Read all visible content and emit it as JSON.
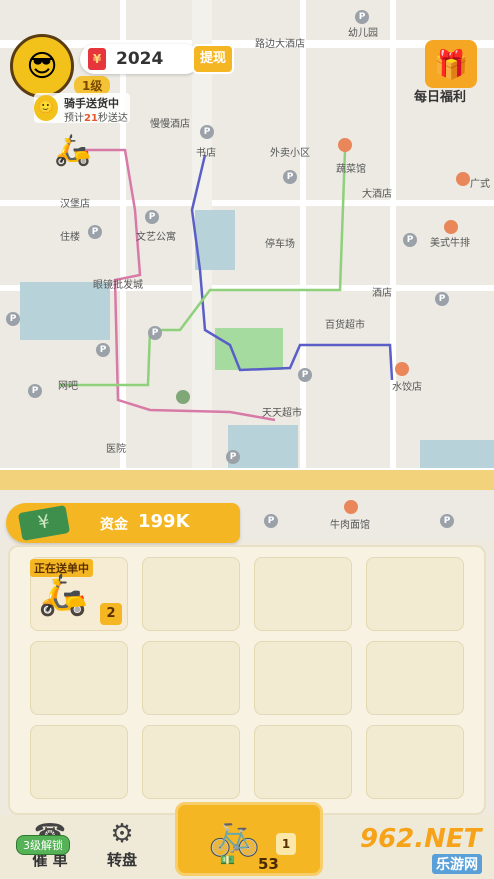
{
  "header": {
    "money_icon": "¥",
    "money": "2024",
    "withdraw": "提现",
    "level": "1级",
    "rider_status": "骑手送货中",
    "eta_prefix": "预计",
    "eta_seconds": "21",
    "eta_suffix": "秒送达",
    "daily_welfare": "每日福利"
  },
  "map": {
    "labels": [
      "路边大酒店",
      "幼儿园",
      "慢慢酒店",
      "书店",
      "外卖小区",
      "蔬菜馆",
      "大酒店",
      "广式",
      "汉堡店",
      "住楼",
      "文艺公寓",
      "停车场",
      "美式牛排",
      "眼镜批发城",
      "酒店",
      "百货超市",
      "水饺店",
      "网吧",
      "天天超市",
      "医院",
      "牛肉面馆"
    ],
    "pin_glyph": "P"
  },
  "funds": {
    "label": "资金",
    "value": "199K"
  },
  "slots": {
    "active_tag": "正在送单中",
    "active_level": "2"
  },
  "bottom": {
    "urge_label": "催 单",
    "unlock_badge": "3级解锁",
    "wheel_label": "转盘",
    "buy_level": "1",
    "buy_cost": "53"
  },
  "watermark": {
    "main": "962.NET",
    "sub": "乐游网"
  },
  "colors": {
    "accent": "#f5b623",
    "route_pink": "#d87aa8",
    "route_blue": "#5a5fc8",
    "route_green": "#8fd07a"
  }
}
